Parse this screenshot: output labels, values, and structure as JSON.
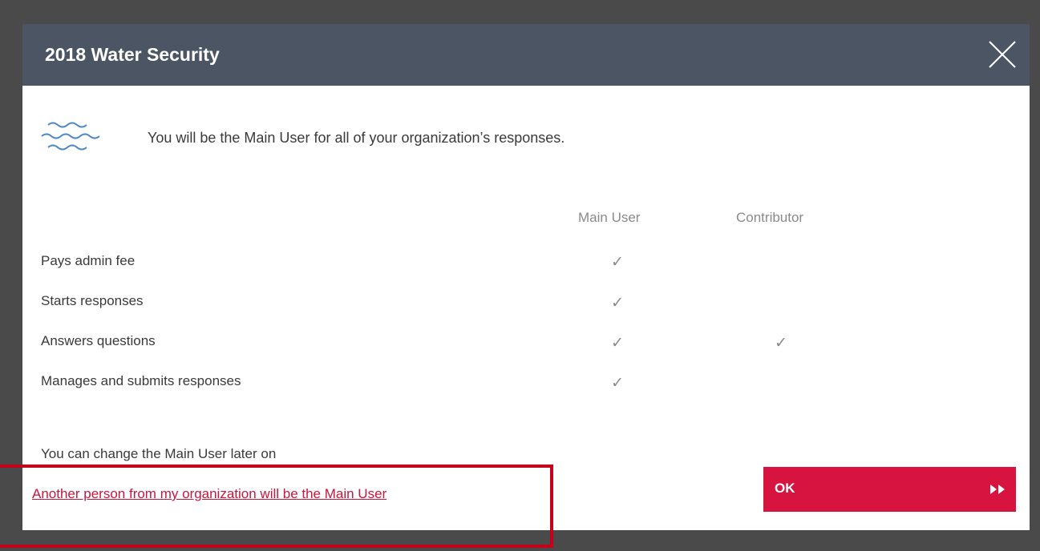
{
  "modal": {
    "title": "2018 Water Security",
    "intro_text": "You will be the Main User for all of your organization’s responses.",
    "columns": [
      "Main User",
      "Contributor"
    ],
    "rows": [
      {
        "label": "Pays admin fee",
        "main_user": "✓",
        "contributor": ""
      },
      {
        "label": "Starts responses",
        "main_user": "✓",
        "contributor": ""
      },
      {
        "label": "Answers questions",
        "main_user": "✓",
        "contributor": "✓"
      },
      {
        "label": "Manages and submits responses",
        "main_user": "✓",
        "contributor": ""
      }
    ],
    "change_note": "You can change the Main User later on",
    "alt_link": "Another person from my organization will be the Main User",
    "ok_label": "OK"
  },
  "icons": {
    "close": "close-icon",
    "water": "water-waves-icon",
    "ok_arrows": "fast-forward-icon"
  },
  "colors": {
    "header_bg": "#4b5564",
    "accent": "#d6143f",
    "link": "#c8163d",
    "highlight": "#c4001a"
  }
}
